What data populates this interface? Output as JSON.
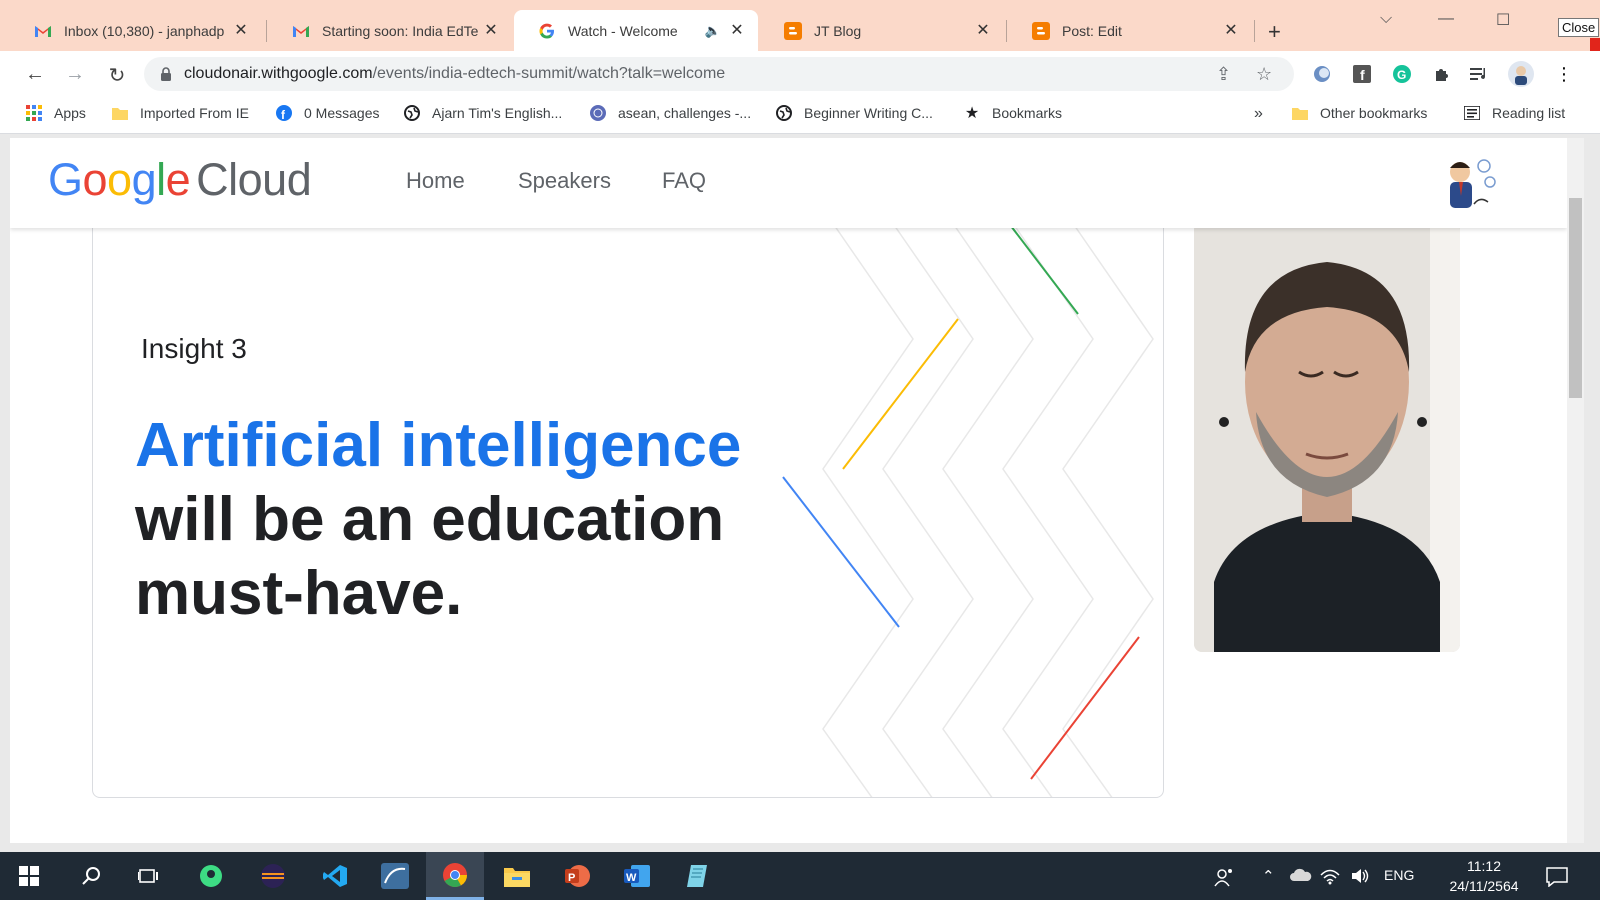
{
  "browser": {
    "tabs": [
      {
        "title": "Inbox (10,380) - janphadp",
        "icon": "gmail-icon",
        "active": false
      },
      {
        "title": "Starting soon: India EdTe",
        "icon": "gmail-icon",
        "active": false
      },
      {
        "title": "Watch - Welcome",
        "icon": "google-icon",
        "active": true
      },
      {
        "title": "JT Blog",
        "icon": "blogger-icon",
        "active": false
      },
      {
        "title": "Post: Edit",
        "icon": "blogger-icon",
        "active": false
      }
    ],
    "close_tooltip": "Close",
    "url_host": "cloudonair.withgoogle.com",
    "url_path": "/events/india-edtech-summit/watch?talk=welcome",
    "bookmarks": [
      {
        "label": "Apps",
        "icon": "apps-grid-icon"
      },
      {
        "label": "Imported From IE",
        "icon": "folder-icon"
      },
      {
        "label": "0 Messages",
        "icon": "facebook-icon"
      },
      {
        "label": "Ajarn Tim's English...",
        "icon": "globe-icon"
      },
      {
        "label": "asean, challenges -...",
        "icon": "un-icon"
      },
      {
        "label": "Beginner Writing C...",
        "icon": "globe-icon"
      },
      {
        "label": "Bookmarks",
        "icon": "star-icon"
      }
    ],
    "overflow": "»",
    "other_bookmarks": "Other bookmarks",
    "reading_list": "Reading list"
  },
  "site": {
    "logo_google": [
      "G",
      "o",
      "o",
      "g",
      "l",
      "e"
    ],
    "logo_cloud": "Cloud",
    "nav": [
      "Home",
      "Speakers",
      "FAQ"
    ]
  },
  "slide": {
    "insight": "Insight 3",
    "headline_highlight": "Artificial intelligence",
    "headline_line2": "will be an education",
    "headline_line3": "must-have."
  },
  "colors": {
    "accent_blue": "#1a73e8",
    "google_blue": "#4285f4",
    "google_red": "#ea4335",
    "google_yellow": "#fbbc05",
    "google_green": "#34a853",
    "tabstrip": "#fbd9c9"
  },
  "taskbar": {
    "language": "ENG",
    "time": "11:12",
    "date": "24/11/2564"
  }
}
